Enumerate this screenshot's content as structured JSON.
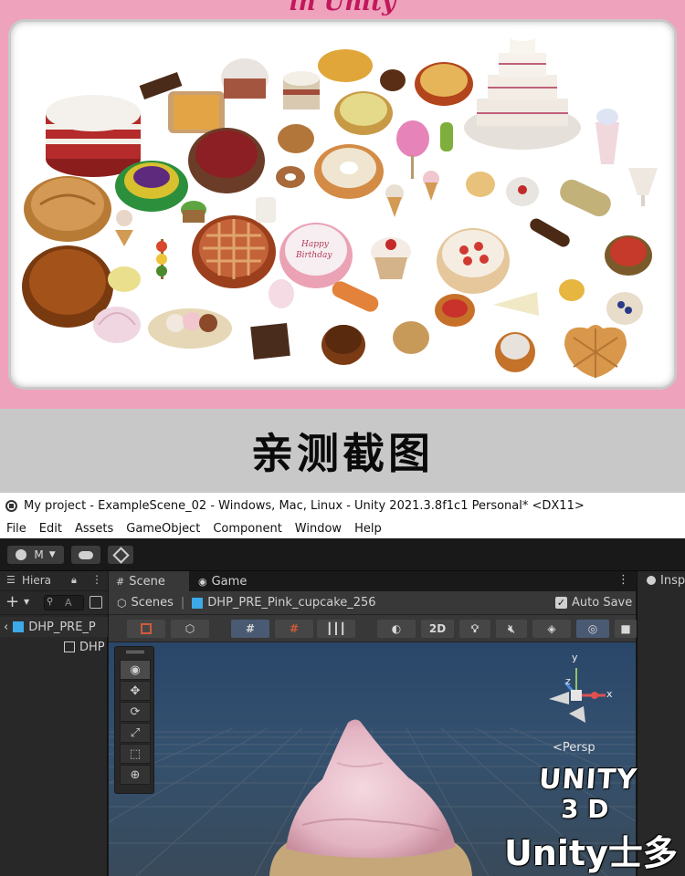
{
  "promo": {
    "title_partial": "in Unity"
  },
  "banner": {
    "text": "亲测截图"
  },
  "window": {
    "title": "My project - ExampleScene_02 - Windows, Mac, Linux - Unity 2021.3.8f1c1 Personal* <DX11>"
  },
  "menu": [
    "File",
    "Edit",
    "Assets",
    "GameObject",
    "Component",
    "Window",
    "Help"
  ],
  "toolbar": {
    "account_label": "M"
  },
  "hierarchy": {
    "tab_label": "Hiera",
    "search_placeholder": "A",
    "rows": [
      "DHP_PRE_P",
      "DHP"
    ]
  },
  "scene": {
    "tabs": [
      "Scene",
      "Game"
    ],
    "breadcrumb_root": "Scenes",
    "breadcrumb_prefab": "DHP_PRE_Pink_cupcake_256",
    "auto_save_label": "Auto Save",
    "auto_save_checked": true,
    "mode_2d_label": "2D",
    "persp_label": "<Persp",
    "axis_labels": [
      "y",
      "z",
      "x"
    ]
  },
  "inspector": {
    "tab_label": "Insp"
  },
  "watermark": {
    "line1": "UNITY",
    "line2": "3 D",
    "line3": "Unity士多"
  },
  "colors": {
    "promo_bg": "#eea2bc",
    "banner_bg": "#c8c8c8",
    "scene_sky": "#2f4a6e",
    "grid_floor": "#3d4a57",
    "cupcake_frosting": "#e8bcc8",
    "cupcake_base": "#c4a878"
  }
}
